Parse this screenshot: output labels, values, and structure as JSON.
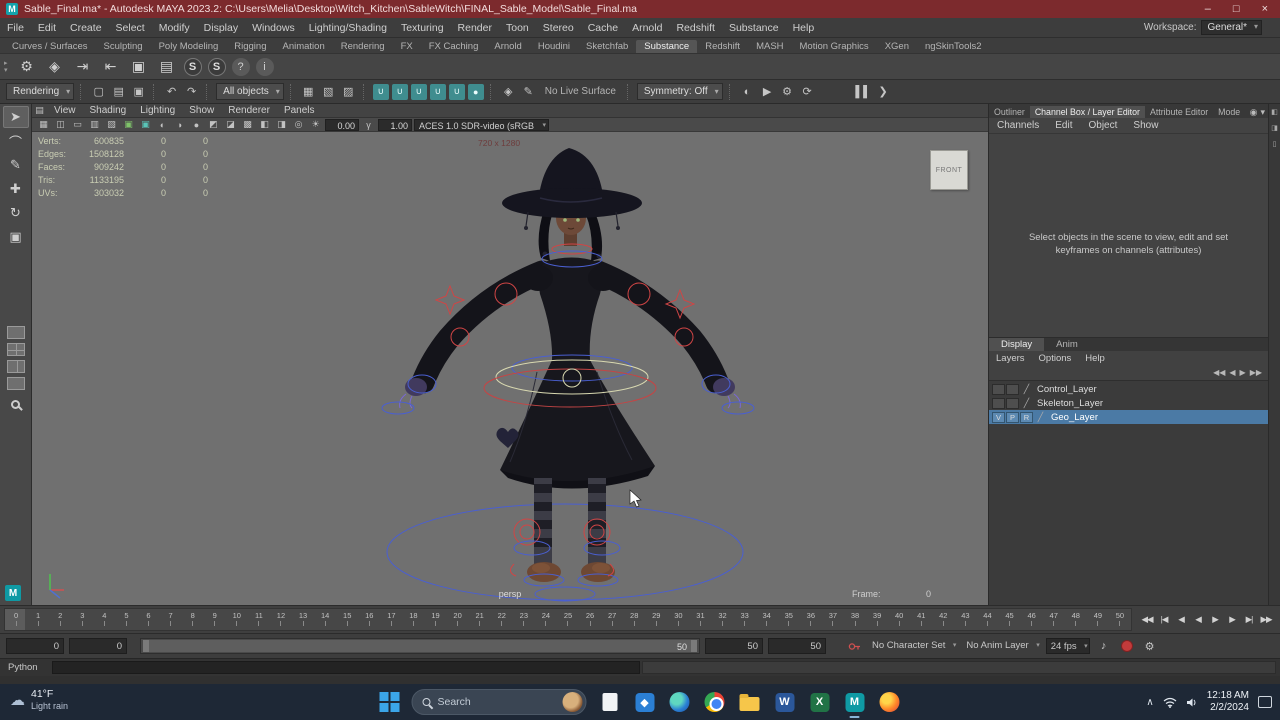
{
  "title_bar": {
    "title": "Sable_Final.ma* - Autodesk MAYA 2023.2: C:\\Users\\Melia\\Desktop\\Witch_Kitchen\\SableWitch\\FINAL_Sable_Model\\Sable_Final.ma",
    "minimize": "–",
    "maximize": "□",
    "close": "×",
    "app_initial": "M"
  },
  "menu_bar": {
    "items": [
      "File",
      "Edit",
      "Create",
      "Select",
      "Modify",
      "Display",
      "Windows",
      "Lighting/Shading",
      "Texturing",
      "Render",
      "Toon",
      "Stereo",
      "Cache",
      "Arnold",
      "Redshift",
      "Substance",
      "Help"
    ],
    "workspace_label": "Workspace:",
    "workspace_value": "General*"
  },
  "shelf": {
    "tabs": [
      {
        "label": "Curves / Surfaces"
      },
      {
        "label": "Sculpting"
      },
      {
        "label": "Poly Modeling"
      },
      {
        "label": "Rigging"
      },
      {
        "label": "Animation"
      },
      {
        "label": "Rendering"
      },
      {
        "label": "FX"
      },
      {
        "label": "FX Caching"
      },
      {
        "label": "Arnold"
      },
      {
        "label": "Houdini"
      },
      {
        "label": "Sketchfab"
      },
      {
        "label": "Substance",
        "active": true
      },
      {
        "label": "Redshift"
      },
      {
        "label": "MASH"
      },
      {
        "label": "Motion Graphics"
      },
      {
        "label": "XGen"
      },
      {
        "label": "ngSkinTools2"
      }
    ]
  },
  "status_line": {
    "renderer_mode": "Rendering",
    "selection_mask": "All objects",
    "live_surface": "No Live Surface",
    "symmetry": "Symmetry: Off"
  },
  "viewport": {
    "panel_menus": [
      "View",
      "Shading",
      "Lighting",
      "Show",
      "Renderer",
      "Panels"
    ],
    "exposure": "0.00",
    "gamma": "1.00",
    "color_space": "ACES 1.0 SDR-video (sRGB",
    "resolution": "720 x 1280",
    "camera": "persp",
    "frame_label": "Frame:",
    "frame_value": "0",
    "image_plane_label": "FRONT",
    "hud": {
      "rows": [
        {
          "label": "Verts:",
          "value": "600835",
          "a": "0",
          "b": "0"
        },
        {
          "label": "Edges:",
          "value": "1508128",
          "a": "0",
          "b": "0"
        },
        {
          "label": "Faces:",
          "value": "909242",
          "a": "0",
          "b": "0"
        },
        {
          "label": "Tris:",
          "value": "1133195",
          "a": "0",
          "b": "0"
        },
        {
          "label": "UVs:",
          "value": "303032",
          "a": "0",
          "b": "0"
        }
      ]
    }
  },
  "right_panel": {
    "tabs": [
      {
        "label": "Outliner"
      },
      {
        "label": "Channel Box / Layer Editor",
        "active": true
      },
      {
        "label": "Attribute Editor"
      },
      {
        "label": "Mode"
      }
    ],
    "menus": [
      "Channels",
      "Edit",
      "Object",
      "Show"
    ],
    "empty_message": "Select objects in the scene to view, edit and set keyframes on channels (attributes)",
    "layer_editor": {
      "tabs": [
        {
          "label": "Display",
          "active": true
        },
        {
          "label": "Anim"
        }
      ],
      "menus": [
        "Layers",
        "Options",
        "Help"
      ],
      "layers": [
        {
          "v": "",
          "p": "",
          "r": "",
          "name": "Control_Layer",
          "selected": false
        },
        {
          "v": "",
          "p": "",
          "r": "",
          "name": "Skeleton_Layer",
          "selected": false
        },
        {
          "v": "V",
          "p": "P",
          "r": "R",
          "name": "Geo_Layer",
          "selected": true
        }
      ]
    }
  },
  "timeline": {
    "current": "0",
    "ticks": [
      "0",
      "1",
      "2",
      "3",
      "4",
      "5",
      "6",
      "7",
      "8",
      "9",
      "10",
      "11",
      "12",
      "13",
      "14",
      "15",
      "16",
      "17",
      "18",
      "19",
      "20",
      "21",
      "22",
      "23",
      "24",
      "25",
      "26",
      "27",
      "28",
      "29",
      "30",
      "31",
      "32",
      "33",
      "34",
      "35",
      "36",
      "37",
      "38",
      "39",
      "40",
      "41",
      "42",
      "43",
      "44",
      "45",
      "46",
      "47",
      "48",
      "49",
      "50"
    ]
  },
  "range_slider": {
    "anim_start": "0",
    "play_start": "0",
    "range_end_label": "50",
    "play_end": "50",
    "anim_end": "50",
    "character_set": "No Character Set",
    "anim_layer": "No Anim Layer",
    "fps": "24 fps"
  },
  "command_line": {
    "language": "Python"
  },
  "taskbar": {
    "weather_temp": "41°F",
    "weather_desc": "Light rain",
    "search_placeholder": "Search",
    "clock_time": "12:18 AM",
    "clock_date": "2/2/2024"
  }
}
